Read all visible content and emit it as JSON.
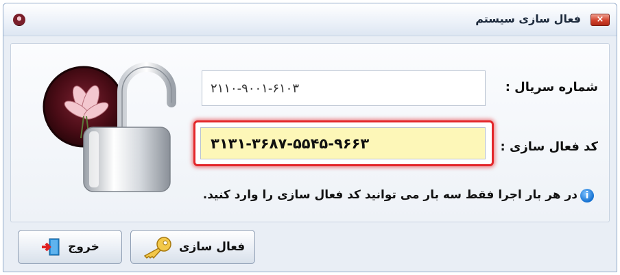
{
  "window": {
    "title": "فعال سازی سیستم",
    "close_label": "×"
  },
  "form": {
    "serial_label": "شماره سریال :",
    "serial_value": "۲۱۱۰-۹۰۰۱-۶۱۰۳",
    "activation_label": "کد فعال سازی :",
    "activation_value": "۳۱۳۱-۳۶۸۷-۵۵۴۵-۹۶۶۳"
  },
  "info": {
    "icon": "info-icon",
    "text": "در هر بار اجرا فقط سه بار می توانید کد فعال سازی را وارد کنید."
  },
  "buttons": {
    "activate_label": "فعال سازی",
    "exit_label": "خروج"
  },
  "colors": {
    "highlight_border": "#e3262a",
    "code_field_bg": "#fdf7b8",
    "close_button": "#d2412c"
  }
}
